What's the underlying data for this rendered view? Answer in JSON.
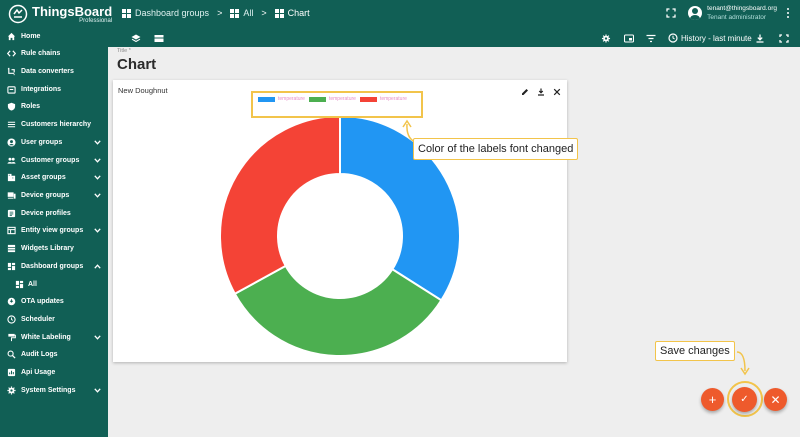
{
  "brand": {
    "name": "ThingsBoard",
    "edition": "Professional"
  },
  "breadcrumbs": [
    {
      "label": "Dashboard groups"
    },
    {
      "label": "All"
    },
    {
      "label": "Chart"
    }
  ],
  "user": {
    "email": "tenant@thingsboard.org",
    "role": "Tenant administrator"
  },
  "sidebar": {
    "items": [
      {
        "label": "Home",
        "icon": "home-icon"
      },
      {
        "label": "Rule chains",
        "icon": "code-icon"
      },
      {
        "label": "Data converters",
        "icon": "converter-icon"
      },
      {
        "label": "Integrations",
        "icon": "integration-icon"
      },
      {
        "label": "Roles",
        "icon": "shield-icon"
      },
      {
        "label": "Customers hierarchy",
        "icon": "hierarchy-icon"
      },
      {
        "label": "User groups",
        "icon": "account-icon"
      },
      {
        "label": "Customer groups",
        "icon": "people-icon"
      },
      {
        "label": "Asset groups",
        "icon": "domain-icon"
      },
      {
        "label": "Device groups",
        "icon": "devices-icon"
      },
      {
        "label": "Device profiles",
        "icon": "profile-icon"
      },
      {
        "label": "Entity view groups",
        "icon": "view-icon"
      },
      {
        "label": "Widgets Library",
        "icon": "widgets-icon"
      },
      {
        "label": "Dashboard groups",
        "icon": "dashboard-icon"
      },
      {
        "label": "All",
        "icon": "dashboard-icon"
      },
      {
        "label": "OTA updates",
        "icon": "update-icon"
      },
      {
        "label": "Scheduler",
        "icon": "schedule-icon"
      },
      {
        "label": "White Labeling",
        "icon": "format-paint-icon"
      },
      {
        "label": "Audit Logs",
        "icon": "audit-icon"
      },
      {
        "label": "Api Usage",
        "icon": "api-icon"
      },
      {
        "label": "System Settings",
        "icon": "settings-icon"
      }
    ]
  },
  "toolbar": {
    "history_label": "History - last minute"
  },
  "page": {
    "title_label": "Title *",
    "title": "Chart"
  },
  "widget": {
    "title": "New Doughnut",
    "legend": [
      {
        "label": "temperature",
        "color": "#2196f3"
      },
      {
        "label": "temperature",
        "color": "#4caf50"
      },
      {
        "label": "temperature",
        "color": "#f44336"
      }
    ],
    "legend_label_color": "#e78ec7"
  },
  "chart_data": {
    "type": "pie",
    "donut": true,
    "series": [
      {
        "name": "temperature",
        "value": 34,
        "color": "#2196f3"
      },
      {
        "name": "temperature",
        "value": 33,
        "color": "#4caf50"
      },
      {
        "name": "temperature",
        "value": 33,
        "color": "#f44336"
      }
    ]
  },
  "annotations": {
    "labels_note": "Color of the labels font changed",
    "save_note": "Save changes"
  },
  "fabs": {
    "add": "+",
    "save": "✓",
    "cancel": "✕"
  },
  "colors": {
    "primary": "#115f55",
    "accent": "#ee5a2c",
    "highlight": "#f2c44b"
  }
}
